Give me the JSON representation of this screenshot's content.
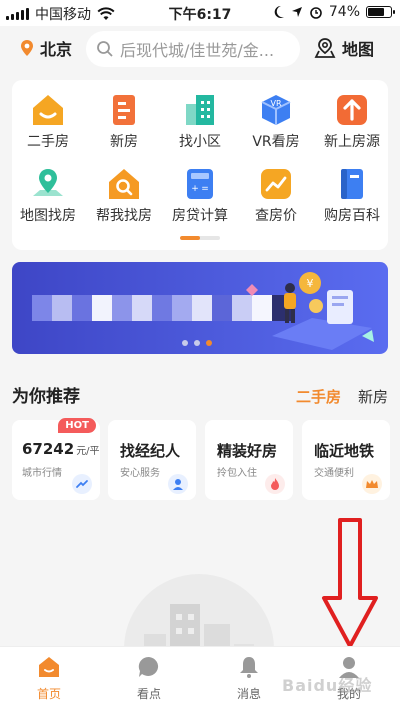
{
  "status_bar": {
    "carrier": "中国移动",
    "time": "下午6:17",
    "battery": "74%",
    "battery_level": 0.74
  },
  "header": {
    "city": "北京",
    "search_placeholder": "后现代城/佳世苑/金...",
    "map_label": "地图"
  },
  "grid": {
    "items": [
      {
        "label": "二手房",
        "icon": "house-icon",
        "color": "#f5a623"
      },
      {
        "label": "新房",
        "icon": "building-icon",
        "color": "#f2713a"
      },
      {
        "label": "找小区",
        "icon": "community-icon",
        "color": "#23b8a0"
      },
      {
        "label": "VR看房",
        "icon": "vr-cube-icon",
        "color": "#3d7ff2"
      },
      {
        "label": "新上房源",
        "icon": "arrow-up-icon",
        "color": "#f26b35"
      },
      {
        "label": "地图找房",
        "icon": "map-pin-icon",
        "color": "#2fbf9a"
      },
      {
        "label": "帮我找房",
        "icon": "house-search-icon",
        "color": "#f59a23"
      },
      {
        "label": "房贷计算",
        "icon": "calculator-icon",
        "color": "#3d7ff2"
      },
      {
        "label": "查房价",
        "icon": "price-trend-icon",
        "color": "#f5a623"
      },
      {
        "label": "购房百科",
        "icon": "book-icon",
        "color": "#3d7ff2"
      }
    ],
    "page_progress": 0.5
  },
  "banner": {
    "slide_index": 3,
    "slide_count": 3
  },
  "recommend": {
    "title": "为你推荐",
    "tabs": [
      {
        "label": "二手房",
        "active": true
      },
      {
        "label": "新房",
        "active": false
      }
    ],
    "cards": [
      {
        "title": "67242",
        "unit": "元/平",
        "subtitle": "城市行情",
        "badge": "HOT",
        "icon": "trend-icon"
      },
      {
        "title": "找经纪人",
        "subtitle": "安心服务",
        "icon": "agent-icon"
      },
      {
        "title": "精装好房",
        "subtitle": "拎包入住",
        "icon": "flame-icon"
      },
      {
        "title": "临近地铁",
        "subtitle": "交通便利",
        "icon": "crown-icon"
      }
    ]
  },
  "tabbar": {
    "tabs": [
      {
        "label": "首页",
        "active": true
      },
      {
        "label": "看点",
        "active": false
      },
      {
        "label": "消息",
        "active": false
      },
      {
        "label": "我的",
        "active": false
      }
    ]
  },
  "colors": {
    "accent": "#f28a2e",
    "banner": "#4a54d6",
    "annotation": "#e02020"
  },
  "watermark": "Baidu经验"
}
